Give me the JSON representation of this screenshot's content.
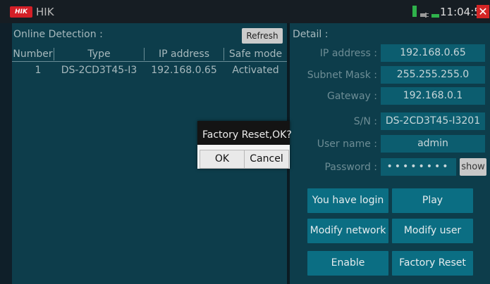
{
  "app": {
    "logo_text": "HIK",
    "title": "HIK",
    "time": "11:04:54",
    "close_icon": "✕"
  },
  "online": {
    "label": "Online Detection :",
    "refresh_label": "Refresh",
    "headers": [
      "Number",
      "Type",
      "IP address",
      "Safe mode"
    ],
    "rows": [
      [
        "1",
        "DS-2CD3T45-I3",
        "192.168.0.65",
        "Activated"
      ]
    ]
  },
  "detail": {
    "label": "Detail :",
    "fields": [
      {
        "label": "IP address :",
        "value": "192.168.0.65"
      },
      {
        "label": "Subnet Mask :",
        "value": "255.255.255.0"
      },
      {
        "label": "Gateway :",
        "value": "192.168.0.1"
      },
      {
        "label": "S/N :",
        "value": "DS-2CD3T45-I3201"
      },
      {
        "label": "User name :",
        "value": "admin"
      },
      {
        "label": "Password :",
        "value": "••••••••"
      }
    ],
    "show_label": "show"
  },
  "actions": {
    "you_have_login": "You have login",
    "play": "Play",
    "modify_network": "Modify network",
    "modify_user": "Modify user",
    "enable": "Enable",
    "factory_reset": "Factory Reset"
  },
  "dialog": {
    "message": "Factory Reset,OK?",
    "ok": "OK",
    "cancel": "Cancel"
  },
  "colors": {
    "panel": "#0d3d4b",
    "field": "#0c5d6f",
    "button": "#0b6e83",
    "close": "#d42525"
  }
}
